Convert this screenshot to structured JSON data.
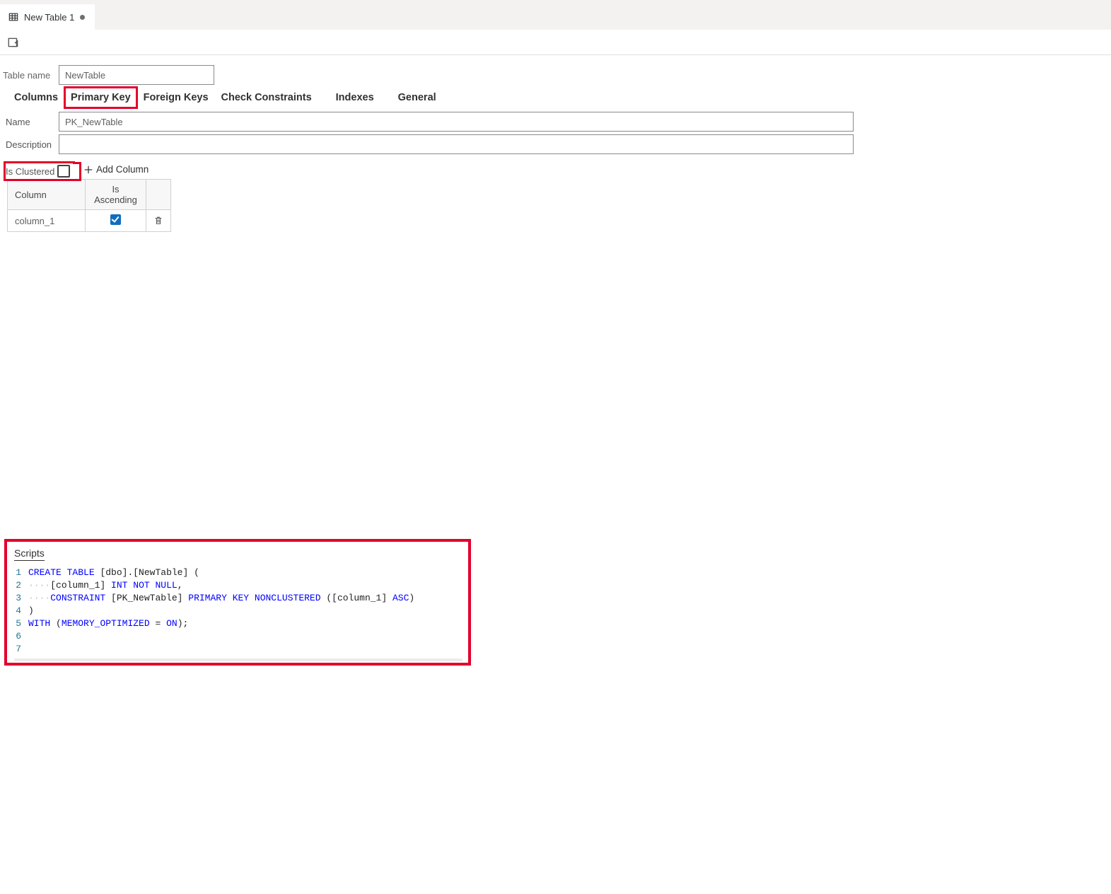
{
  "doc_tab": {
    "title": "New Table 1"
  },
  "form": {
    "table_name_label": "Table name",
    "table_name_value": "NewTable"
  },
  "sub_tabs": {
    "columns": "Columns",
    "primary_key": "Primary Key",
    "foreign_keys": "Foreign Keys",
    "check_constraints": "Check Constraints",
    "indexes": "Indexes",
    "general": "General"
  },
  "pk": {
    "name_label": "Name",
    "name_value": "PK_NewTable",
    "description_label": "Description",
    "description_value": "",
    "is_clustered_label": "Is Clustered",
    "is_clustered": false,
    "add_column_label": "Add Column",
    "headers": {
      "column": "Column",
      "is_ascending": "Is Ascending"
    },
    "rows": [
      {
        "column": "column_1",
        "is_ascending": true
      }
    ]
  },
  "scripts": {
    "title": "Scripts",
    "lines": [
      {
        "n": "1",
        "segs": [
          [
            "kw",
            "CREATE"
          ],
          [
            "sp",
            " "
          ],
          [
            "kw",
            "TABLE"
          ],
          [
            "sp",
            " "
          ],
          [
            "id",
            "[dbo].[NewTable] ("
          ]
        ]
      },
      {
        "n": "2",
        "segs": [
          [
            "dots",
            "····"
          ],
          [
            "id",
            "[column_1] "
          ],
          [
            "kw",
            "INT"
          ],
          [
            "sp",
            " "
          ],
          [
            "kw",
            "NOT"
          ],
          [
            "sp",
            " "
          ],
          [
            "kw",
            "NULL"
          ],
          [
            "id",
            ","
          ]
        ]
      },
      {
        "n": "3",
        "segs": [
          [
            "dots",
            "····"
          ],
          [
            "kw",
            "CONSTRAINT"
          ],
          [
            "sp",
            " "
          ],
          [
            "id",
            "[PK_NewTable] "
          ],
          [
            "kw",
            "PRIMARY"
          ],
          [
            "sp",
            " "
          ],
          [
            "kw",
            "KEY"
          ],
          [
            "sp",
            " "
          ],
          [
            "kw",
            "NONCLUSTERED"
          ],
          [
            "sp",
            " "
          ],
          [
            "id",
            "([column_1] "
          ],
          [
            "kw",
            "ASC"
          ],
          [
            "id",
            ")"
          ]
        ]
      },
      {
        "n": "4",
        "segs": [
          [
            "id",
            ")"
          ]
        ]
      },
      {
        "n": "5",
        "segs": [
          [
            "kw",
            "WITH"
          ],
          [
            "sp",
            " "
          ],
          [
            "id",
            "("
          ],
          [
            "kw",
            "MEMORY_OPTIMIZED"
          ],
          [
            "sp",
            " "
          ],
          [
            "id",
            "= "
          ],
          [
            "kw",
            "ON"
          ],
          [
            "id",
            ");"
          ]
        ]
      },
      {
        "n": "6",
        "segs": []
      },
      {
        "n": "7",
        "segs": []
      }
    ]
  }
}
